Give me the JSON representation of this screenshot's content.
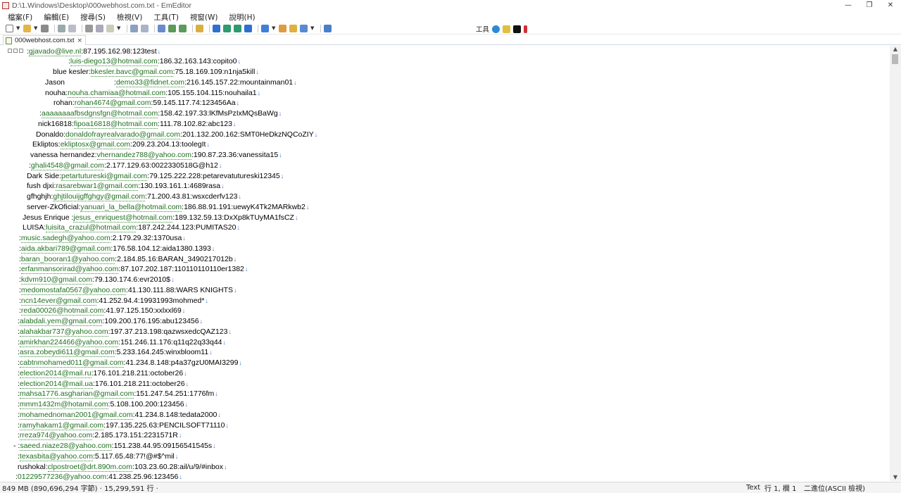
{
  "window": {
    "title": "D:\\1.Windows\\Desktop\\000webhost.com.txt - EmEditor",
    "minimize": "—",
    "restore": "❐",
    "close": "✕"
  },
  "menu": [
    "檔案(F)",
    "編輯(E)",
    "搜尋(S)",
    "檢視(V)",
    "工具(T)",
    "視窗(W)",
    "說明(H)"
  ],
  "toolbar": {
    "tools_label": "工具"
  },
  "tab": {
    "label": "000webhost.com.txt",
    "close": "×"
  },
  "editor": {
    "lines": [
      {
        "prefix": ":",
        "email": "gjavado@live.nl",
        "suffix": ":87.195.162.98:123test"
      },
      {
        "prefix": ":",
        "email": "luis-diego13@hotmail.com",
        "suffix": ":186.32.163.143:copito0"
      },
      {
        "prefix": "blue kesler:",
        "email": "bkesler.bavc@gmail.com",
        "suffix": ":75.18.169.109:n1nja5kill"
      },
      {
        "prefix": "Jason                        :",
        "email": "demo33@fidnet.com",
        "suffix": ":216.145.157.22:mountainman01"
      },
      {
        "prefix": "nouha:",
        "email": "nouha.chamiaa@hotmail.com",
        "suffix": ":105.155.104.115:nouhaila1"
      },
      {
        "prefix": "rohan:",
        "email": "rohan4674@gmail.com",
        "suffix": ":59.145.117.74:123456Aa"
      },
      {
        "prefix": ":",
        "email": "aaaaaaaafbsdgnsfgn@hotmail.com",
        "suffix": ":158.42.197.33:lKfMsPzIxMQsBaWg"
      },
      {
        "prefix": "nick16818:",
        "email": "fipoa16818@hotmail.com",
        "suffix": ":111.78.102.82:abc123"
      },
      {
        "prefix": "Donaldo:",
        "email": "donaldofrayrealvarado@gmail.com",
        "suffix": ":201.132.200.162:SMT0HeDkzNQCoZIY"
      },
      {
        "prefix": "Ekliptos:",
        "email": "ekliptosx@gmail.com",
        "suffix": ":209.23.204.13:toolegIt"
      },
      {
        "prefix": "vanessa hernandez:",
        "email": "vhernandez788@yahoo.com",
        "suffix": ":190.87.23.36:vanessita15"
      },
      {
        "prefix": ":",
        "email": "ghali4548@gmail.com",
        "suffix": ":2.177.129.63:0022330518G@h12"
      },
      {
        "prefix": "Dark Side:",
        "email": "petartutureski@gmail.com",
        "suffix": ":79.125.222.228:petarevatutureski12345"
      },
      {
        "prefix": "fush djxi:",
        "email": "rasarebwar1@gmail.com",
        "suffix": ":130.193.161.1:4689rasa"
      },
      {
        "prefix": "gfhghjh:",
        "email": "ghjtilouijgffghgy@gmail.com",
        "suffix": ":71.200.43.81:wsxcderfv123"
      },
      {
        "prefix": "server-ZkOficial:",
        "email": "yanuari_la_bella@hotmail.com",
        "suffix": ":186.88.91.191:uewyK4Tk2MARkwb2"
      },
      {
        "prefix": "Jesus Enrique :",
        "email": "jesus_enriquest@hotmail.com",
        "suffix": ":189.132.59.13:DxXp8kTUyMA1fsCZ"
      },
      {
        "prefix": "LUISA:",
        "email": "luisita_crazul@hotmail.com",
        "suffix": ":187.242.244.123:PUMITAS20"
      },
      {
        "prefix": ":",
        "email": "music.sadegh@yahoo.com",
        "suffix": ":2.179.29.32:1370usa"
      },
      {
        "prefix": ":",
        "email": "aida.akbari789@gmail.com",
        "suffix": ":176.58.104.12:aida1380.1393"
      },
      {
        "prefix": ":",
        "email": "baran_booran1@yahoo.com",
        "suffix": ":2.184.85.16:BARAN_3490217012b"
      },
      {
        "prefix": ":",
        "email": "erfanmansorirad@yahoo.com",
        "suffix": ":87.107.202.187:110110110110er1382"
      },
      {
        "prefix": ":",
        "email": "kdvm910@gmail.com",
        "suffix": ":79.130.174.6:evr2010$"
      },
      {
        "prefix": ":",
        "email": "medomostafa0567@yahoo.com",
        "suffix": ":41.130.111.88:WARS KNIGHTS"
      },
      {
        "prefix": ":",
        "email": "ncn14ever@gmail.com",
        "suffix": ":41.252.94.4:19931993mohmed*"
      },
      {
        "prefix": ":",
        "email": "reda00026@hotmail.com",
        "suffix": ":41.97.125.150:xxlxxl69"
      },
      {
        "prefix": ":",
        "email": "alabdali.yem@gmail.com",
        "suffix": ":109.200.176.195:abu123456"
      },
      {
        "prefix": ":",
        "email": "alahakbar737@yahoo.com",
        "suffix": ":197.37.213.198:qazwsxedcQAZ123"
      },
      {
        "prefix": ":",
        "email": "amirkhan224466@yahoo.com",
        "suffix": ":151.246.11.176:q11q22q33q44"
      },
      {
        "prefix": ":",
        "email": "asra.zobeydi611@gmail.com",
        "suffix": ":5.233.164.245:winxbloom11"
      },
      {
        "prefix": ":",
        "email": "cabtnmohamed011@gmail.com",
        "suffix": ":41.234.8.148:p4a37gzU0MAI3299"
      },
      {
        "prefix": ":",
        "email": "election2014@mail.ru",
        "suffix": ":176.101.218.211:october26"
      },
      {
        "prefix": ":",
        "email": "election2014@mail.ua",
        "suffix": ":176.101.218.211:october26"
      },
      {
        "prefix": ":",
        "email": "mahsa1776.asgharian@gmail.com",
        "suffix": ":151.247.54.251:1776fm"
      },
      {
        "prefix": ":",
        "email": "mmm1432m@hotamil.com",
        "suffix": ":5.108.100.200:123456"
      },
      {
        "prefix": ":",
        "email": "mohamednoman2001@gmail.com",
        "suffix": ":41.234.8.148:tedata2000"
      },
      {
        "prefix": ":",
        "email": "ramyhakam1@gmail.com",
        "suffix": ":197.135.225.63:PENCILSOFT71110"
      },
      {
        "prefix": ":",
        "email": "rreza974@yahoo.com",
        "suffix": ":2.185.173.151:2231571R"
      },
      {
        "prefix": "- :",
        "email": "saeed.niaze28@yahoo.com",
        "suffix": ":151.238.44.95:09156541545s"
      },
      {
        "prefix": ":",
        "email": "texasbita@yahoo.com",
        "suffix": ":5.117.65.48:77!@#$^mil"
      },
      {
        "prefix": "rushokal:",
        "email": "clpostroet@drt.890m.com",
        "suffix": ":103.23.60.28:ail/u/9/#inbox"
      },
      {
        "prefix": ":",
        "email": "01229577236@yahoo.com",
        "suffix": ":41.238.25.96:123456"
      }
    ]
  },
  "status": {
    "left": "849 MB (890,696,294 字節) ·  15,299,591 行 ·",
    "type": "Text",
    "position": "行 1, 欄 1",
    "encoding": "二進位(ASCII 檢視)"
  },
  "colors": {
    "email": "#1f6f1f",
    "eol_marker": "#3a78d2",
    "status_bg": "#f4f4f4"
  }
}
